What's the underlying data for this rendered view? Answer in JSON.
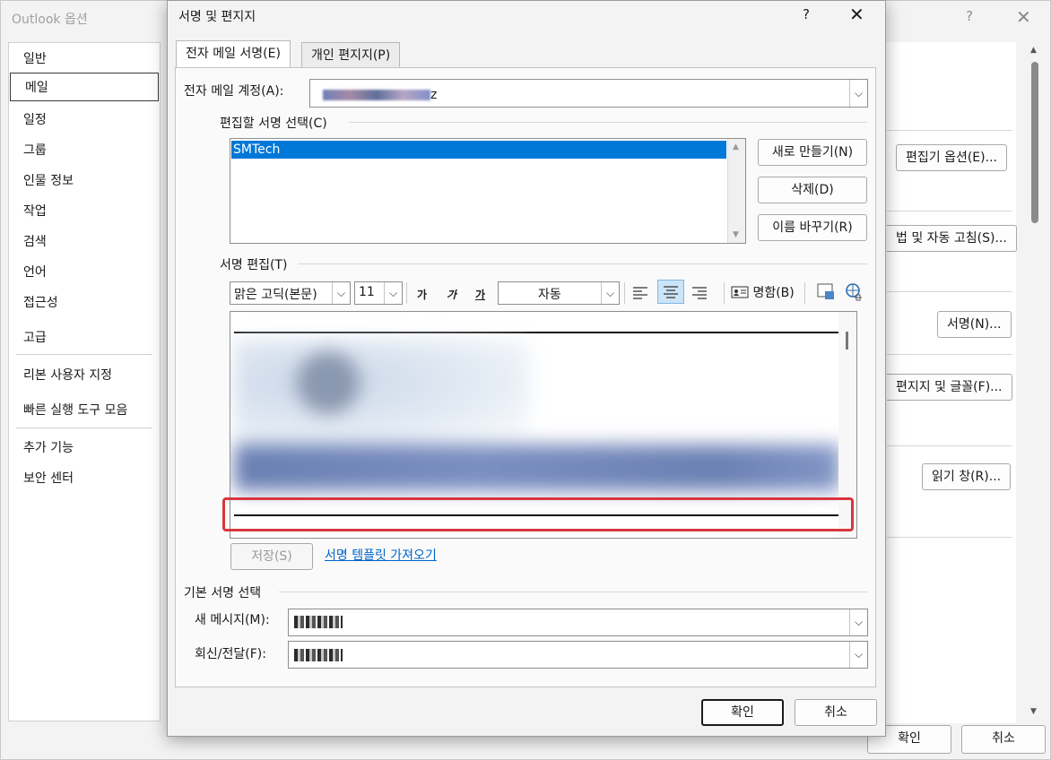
{
  "outer": {
    "title": "Outlook 옵션",
    "help": "?",
    "close": "✕",
    "nav": [
      {
        "label": "일반"
      },
      {
        "label": "메일"
      },
      {
        "label": "일정"
      },
      {
        "label": "그룹"
      },
      {
        "label": "인물 정보"
      },
      {
        "label": "작업"
      },
      {
        "label": "검색"
      },
      {
        "label": "언어"
      },
      {
        "label": "접근성"
      },
      {
        "label": "고급"
      },
      {
        "label": "리본 사용자 지정"
      },
      {
        "label": "빠른 실행 도구 모음"
      },
      {
        "label": "추가 기능"
      },
      {
        "label": "보안 센터"
      }
    ],
    "selected_nav": "메일",
    "buttons": {
      "editor_options": "편집기 옵션(E)...",
      "spelling": "법 및 자동 고침(S)...",
      "signatures": "서명(N)...",
      "stationery": "편지지 및 글꼴(F)...",
      "reading_pane": "읽기 창(R)..."
    },
    "ok": "확인",
    "cancel": "취소"
  },
  "dialog": {
    "title": "서명 및 편지지",
    "help": "?",
    "close": "✕",
    "tabs": [
      "전자 메일 서명(E)",
      "개인 편지지(P)"
    ],
    "email_account_label": "전자 메일 계정(A):",
    "email_account_suffix": "z",
    "select_signature_label": "편집할 서명 선택(C)",
    "signatures": [
      "SMTech"
    ],
    "new_button": "새로 만들기(N)",
    "delete_button": "삭제(D)",
    "rename_button": "이름 바꾸기(R)",
    "edit_signature_label": "서명 편집(T)",
    "toolbar": {
      "font": "맑은 고딕(본문)",
      "size": "11",
      "bold": "가",
      "italic": "가",
      "underline": "가",
      "color": "자동",
      "business_card": "명함(B)"
    },
    "save_button": "저장(S)",
    "template_link": "서명 템플릿 가져오기",
    "default_signature_label": "기본 서명 선택",
    "new_message_label": "새 메시지(M):",
    "reply_forward_label": "회신/전달(F):",
    "ok": "확인",
    "cancel": "취소"
  },
  "colors": {
    "selection": "#0078d7",
    "highlight": "#d9363e",
    "link": "#0066cc"
  }
}
